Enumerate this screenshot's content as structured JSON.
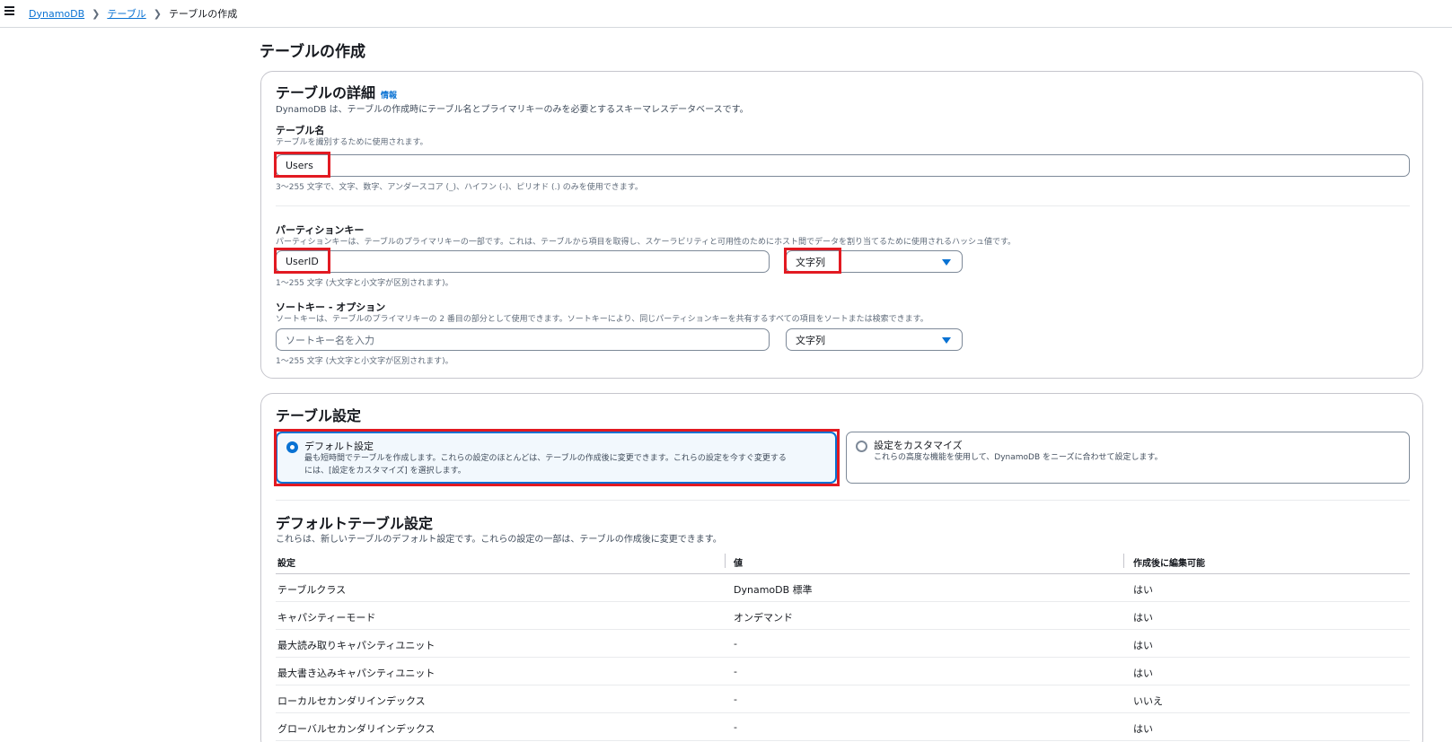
{
  "breadcrumb": {
    "root": "DynamoDB",
    "tables": "テーブル",
    "current": "テーブルの作成"
  },
  "page_title": "テーブルの作成",
  "details": {
    "heading": "テーブルの詳細",
    "info_link": "情報",
    "description": "DynamoDB は、テーブルの作成時にテーブル名とプライマリキーのみを必要とするスキーマレスデータベースです。",
    "table_name": {
      "label": "テーブル名",
      "description": "テーブルを識別するために使用されます。",
      "value": "Users",
      "constraint": "3～255 文字で、文字、数字、アンダースコア (_)、ハイフン (-)、ピリオド (.) のみを使用できます。"
    },
    "partition_key": {
      "label": "パーティションキー",
      "description": "パーティションキーは、テーブルのプライマリキーの一部です。これは、テーブルから項目を取得し、スケーラビリティと可用性のためにホスト間でデータを割り当てるために使用されるハッシュ値です。",
      "value": "UserID",
      "type": "文字列",
      "constraint": "1～255 文字 (大文字と小文字が区別されます)。"
    },
    "sort_key": {
      "label": "ソートキー - オプション",
      "description": "ソートキーは、テーブルのプライマリキーの 2 番目の部分として使用できます。ソートキーにより、同じパーティションキーを共有するすべての項目をソートまたは検索できます。",
      "placeholder": "ソートキー名を入力",
      "type": "文字列",
      "constraint": "1～255 文字 (大文字と小文字が区別されます)。"
    }
  },
  "settings": {
    "heading": "テーブル設定",
    "default_option": {
      "title": "デフォルト設定",
      "desc_line1": "最も短時間でテーブルを作成します。これらの設定のほとんどは、テーブルの作成後に変更できます。これらの設定を今すぐ変更する",
      "desc_line2": "には、[設定をカスタマイズ] を選択します。",
      "selected": true
    },
    "custom_option": {
      "title": "設定をカスタマイズ",
      "desc": "これらの高度な機能を使用して、DynamoDB をニーズに合わせて設定します。",
      "selected": false
    }
  },
  "default_table_settings": {
    "heading": "デフォルトテーブル設定",
    "description": "これらは、新しいテーブルのデフォルト設定です。これらの設定の一部は、テーブルの作成後に変更できます。",
    "columns": [
      "設定",
      "値",
      "作成後に編集可能"
    ],
    "rows": [
      [
        "テーブルクラス",
        "DynamoDB 標準",
        "はい"
      ],
      [
        "キャパシティーモード",
        "オンデマンド",
        "はい"
      ],
      [
        "最大読み取りキャパシティユニット",
        "-",
        "はい"
      ],
      [
        "最大書き込みキャパシティユニット",
        "-",
        "はい"
      ],
      [
        "ローカルセカンダリインデックス",
        "-",
        "いいえ"
      ],
      [
        "グローバルセカンダリインデックス",
        "-",
        "はい"
      ]
    ]
  },
  "colors": {
    "accent": "#0972d3",
    "highlight": "#e21a22",
    "selected_tile_bg": "#f2f8fd"
  }
}
